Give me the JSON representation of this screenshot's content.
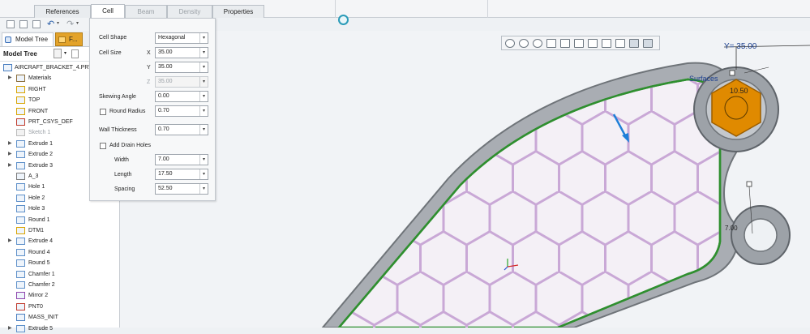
{
  "ribbon": {
    "tabs": [
      {
        "label": "References",
        "state": "normal"
      },
      {
        "label": "Cell",
        "state": "active"
      },
      {
        "label": "Beam",
        "state": "disabled"
      },
      {
        "label": "Density",
        "state": "disabled"
      },
      {
        "label": "Properties",
        "state": "normal"
      }
    ]
  },
  "model_tree": {
    "tabs": [
      {
        "label": "Model Tree"
      },
      {
        "label": "F..."
      }
    ],
    "header_label": "Model Tree",
    "items": [
      {
        "label": "AIRCRAFT_BRACKET_4.PRT",
        "icon": "part-icon",
        "expandable": false,
        "dim": false
      },
      {
        "label": "Materials",
        "icon": "materials-icon",
        "expandable": true,
        "dim": false
      },
      {
        "label": "RIGHT",
        "icon": "datum-plane-icon",
        "expandable": false,
        "dim": false
      },
      {
        "label": "TOP",
        "icon": "datum-plane-icon",
        "expandable": false,
        "dim": false
      },
      {
        "label": "FRONT",
        "icon": "datum-plane-icon",
        "expandable": false,
        "dim": false
      },
      {
        "label": "PRT_CSYS_DEF",
        "icon": "csys-icon",
        "expandable": false,
        "dim": false
      },
      {
        "label": "Sketch 1",
        "icon": "sketch-icon",
        "expandable": false,
        "dim": true
      },
      {
        "label": "Extrude 1",
        "icon": "extrude-icon",
        "expandable": true,
        "dim": false
      },
      {
        "label": "Extrude 2",
        "icon": "extrude-icon",
        "expandable": true,
        "dim": false
      },
      {
        "label": "Extrude 3",
        "icon": "extrude-icon",
        "expandable": true,
        "dim": false
      },
      {
        "label": "A_3",
        "icon": "axis-icon",
        "expandable": false,
        "dim": false
      },
      {
        "label": "Hole 1",
        "icon": "hole-icon",
        "expandable": false,
        "dim": false
      },
      {
        "label": "Hole 2",
        "icon": "hole-icon",
        "expandable": false,
        "dim": false
      },
      {
        "label": "Hole 3",
        "icon": "hole-icon",
        "expandable": false,
        "dim": false
      },
      {
        "label": "Round 1",
        "icon": "round-icon",
        "expandable": false,
        "dim": false
      },
      {
        "label": "DTM1",
        "icon": "datum-plane-icon",
        "expandable": false,
        "dim": false
      },
      {
        "label": "Extrude 4",
        "icon": "extrude-icon",
        "expandable": true,
        "dim": false
      },
      {
        "label": "Round 4",
        "icon": "round-icon",
        "expandable": false,
        "dim": false
      },
      {
        "label": "Round 5",
        "icon": "round-icon",
        "expandable": false,
        "dim": false
      },
      {
        "label": "Chamfer 1",
        "icon": "chamfer-icon",
        "expandable": false,
        "dim": false
      },
      {
        "label": "Chamfer 2",
        "icon": "chamfer-icon",
        "expandable": false,
        "dim": false
      },
      {
        "label": "Mirror 2",
        "icon": "mirror-icon",
        "expandable": false,
        "dim": false
      },
      {
        "label": "PNT0",
        "icon": "datum-point-icon",
        "expandable": false,
        "dim": false
      },
      {
        "label": "MASS_INIT",
        "icon": "mass-icon",
        "expandable": false,
        "dim": false
      },
      {
        "label": "Extrude 5",
        "icon": "extrude-icon",
        "expandable": true,
        "dim": false
      }
    ]
  },
  "cell_panel": {
    "cell_shape": {
      "label": "Cell Shape",
      "value": "Hexagonal"
    },
    "cell_size": {
      "label": "Cell Size",
      "x": {
        "axis": "X",
        "value": "35.00"
      },
      "y": {
        "axis": "Y",
        "value": "35.00"
      },
      "z": {
        "axis": "Z",
        "value": "35.00"
      }
    },
    "skewing_angle": {
      "label": "Skewing Angle",
      "value": "0.00"
    },
    "round_radius": {
      "label": "Round Radius",
      "value": "0.70",
      "checked": false
    },
    "wall_thickness": {
      "label": "Wall Thickness",
      "value": "0.70"
    },
    "drain_holes": {
      "label": "Add Drain Holes",
      "checked": false
    },
    "width": {
      "label": "Width",
      "value": "7.00"
    },
    "length": {
      "label": "Length",
      "value": "17.50"
    },
    "spacing": {
      "label": "Spacing",
      "value": "52.50"
    }
  },
  "viewport": {
    "annotations": {
      "y_dim": "Y= 35.00",
      "surfaces_label": "Surfaces",
      "dim_small": "10.50",
      "dim_bottom": "7.00"
    },
    "colors": {
      "lattice": "#c9a8d6",
      "bracket_outline": "#2f8f2f",
      "bracket_body": "#8d9299",
      "hex_handle": "#e08a00",
      "arrow": "#1e7fd8"
    },
    "view_tools": [
      "refit-icon",
      "zoom-in-icon",
      "zoom-out-icon",
      "repaint-icon",
      "orient-icon",
      "saved-views-icon",
      "display-style-icon",
      "datum-display-icon",
      "annotation-display-icon",
      "spin-center-icon",
      "view-manager-icon"
    ]
  }
}
